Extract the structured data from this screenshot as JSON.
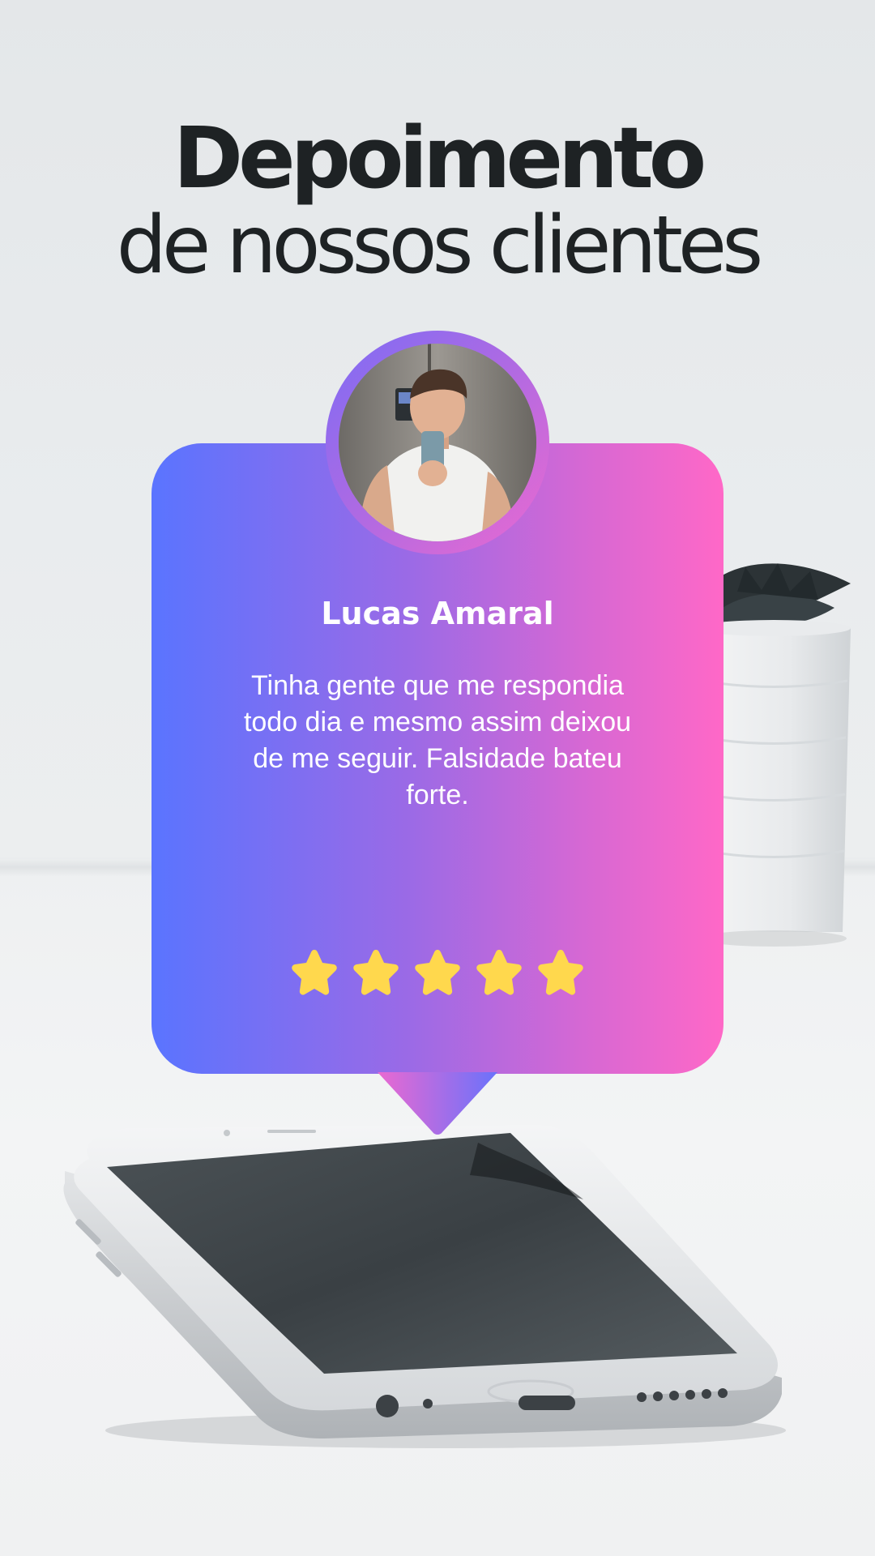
{
  "title": {
    "line1": "Depoimento",
    "line2": "de nossos clientes"
  },
  "testimonial": {
    "name": "Lucas Amaral",
    "text": "Tinha gente que me respondia todo dia e mesmo assim deixou de me seguir. Falsidade bateu forte.",
    "rating": 5,
    "rating_max": 5,
    "stars": [
      {
        "filled": true
      },
      {
        "filled": true
      },
      {
        "filled": true
      },
      {
        "filled": true
      },
      {
        "filled": true
      }
    ]
  },
  "colors": {
    "card_gradient_start": "#5a74ff",
    "card_gradient_end": "#ff68c7",
    "star": "#ffd84d",
    "title": "#1e2224",
    "background": "#e6e9eb"
  },
  "icons": {
    "star": "star-icon",
    "avatar": "user-avatar-photo"
  }
}
